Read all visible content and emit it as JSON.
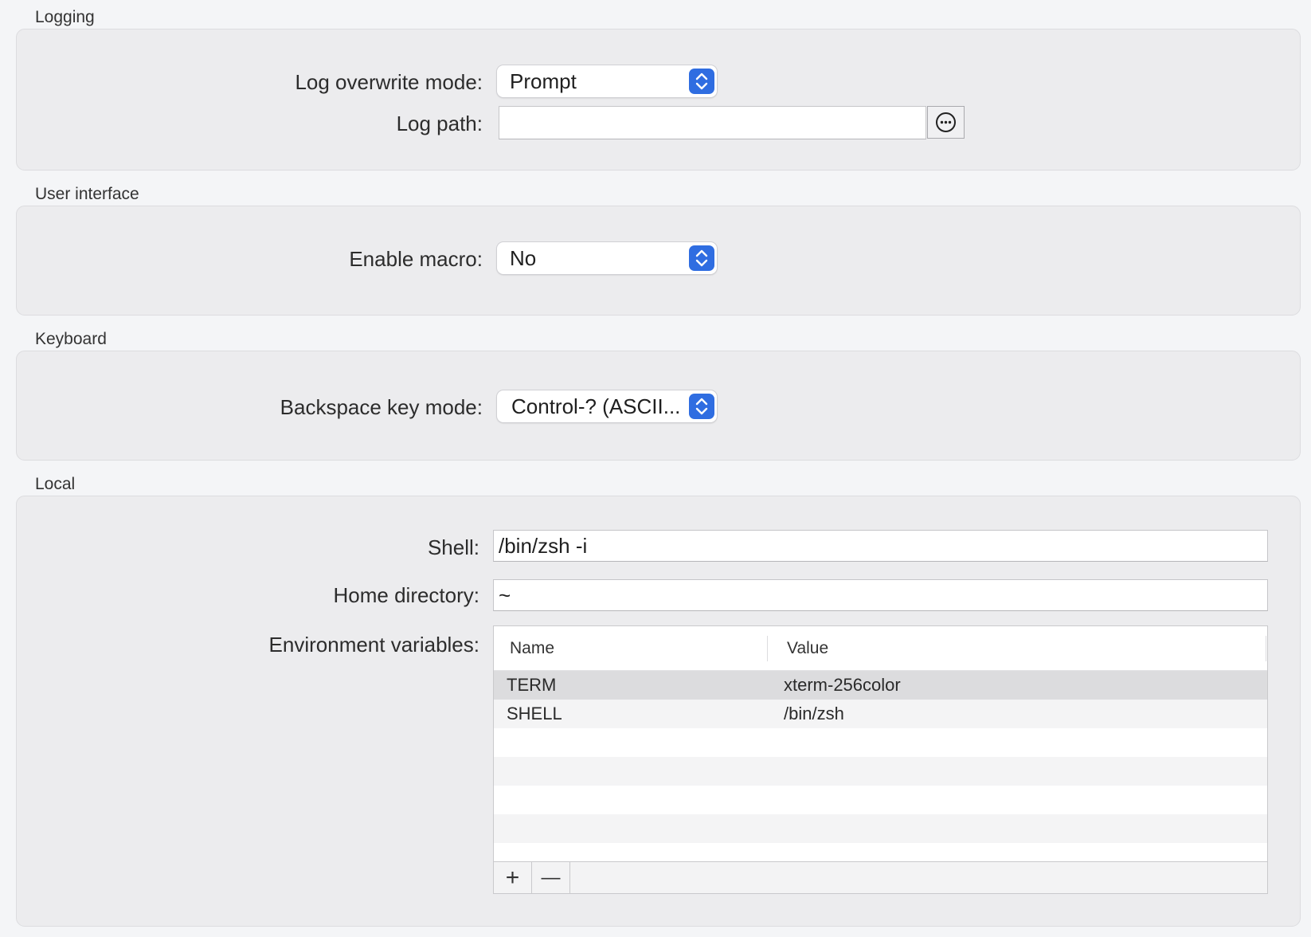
{
  "logging": {
    "title": "Logging",
    "overwrite_label": "Log overwrite mode:",
    "overwrite_value": "Prompt",
    "path_label": "Log path:",
    "path_value": ""
  },
  "user_interface": {
    "title": "User interface",
    "macro_label": "Enable macro:",
    "macro_value": "No"
  },
  "keyboard": {
    "title": "Keyboard",
    "backspace_label": "Backspace key mode:",
    "backspace_value": "Control-? (ASCII..."
  },
  "local": {
    "title": "Local",
    "shell_label": "Shell:",
    "shell_value": "/bin/zsh -i",
    "home_label": "Home directory:",
    "home_value": "~",
    "env_label": "Environment variables:",
    "env_table": {
      "columns": [
        "Name",
        "Value"
      ],
      "rows": [
        {
          "name": "TERM",
          "value": "xterm-256color"
        },
        {
          "name": "SHELL",
          "value": "/bin/zsh"
        }
      ],
      "add_label": "+",
      "remove_label": "—"
    }
  },
  "colors": {
    "accent": "#2f6de1",
    "selected_row": "#dcdcde",
    "stripe": "#f4f4f5"
  },
  "icons": {
    "browse": "ellipsis-circle-icon",
    "popup": "up-down-chevrons-icon"
  }
}
